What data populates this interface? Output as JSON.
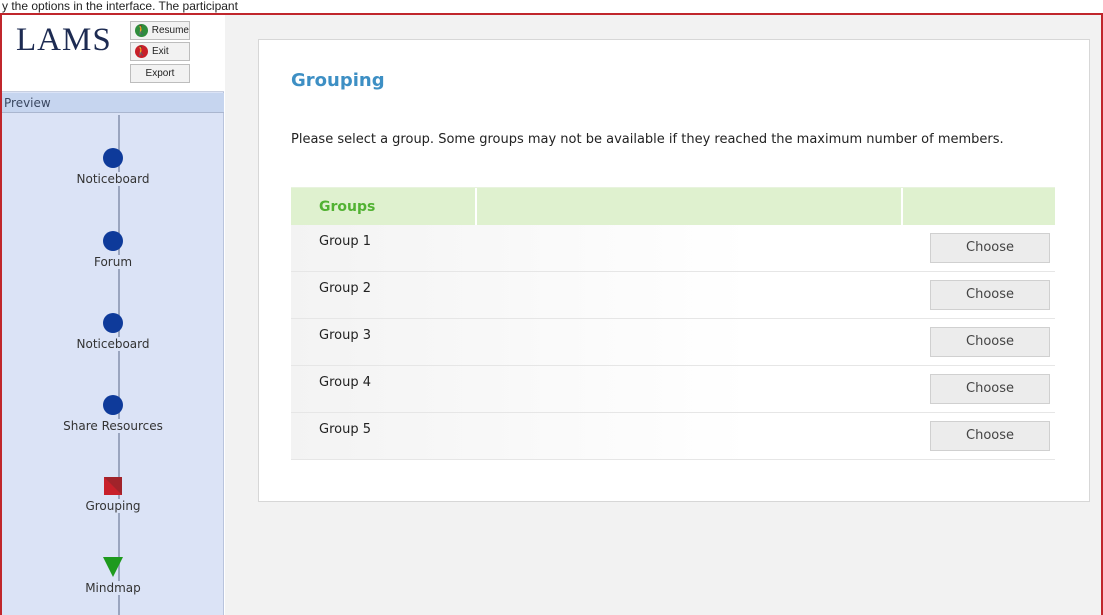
{
  "caption": "y the options in the interface. The participant",
  "toolbar": {
    "logo": "LAMS",
    "resume_label": "Resume",
    "exit_label": "Exit",
    "export_label": "Export",
    "resume_icon": "walking-person-icon",
    "exit_icon": "exit-person-icon"
  },
  "sidebar": {
    "preview_label": "Preview",
    "activities": [
      {
        "label": "Noticeboard",
        "shape": "circle"
      },
      {
        "label": "Forum",
        "shape": "circle"
      },
      {
        "label": "Noticeboard",
        "shape": "circle"
      },
      {
        "label": "Share Resources",
        "shape": "circle"
      },
      {
        "label": "Grouping",
        "shape": "square"
      },
      {
        "label": "Mindmap",
        "shape": "triangle"
      }
    ]
  },
  "main": {
    "title": "Grouping",
    "instructions": "Please select a group. Some groups may not be available if they reached the maximum number of members.",
    "table": {
      "header": "Groups",
      "rows": [
        {
          "name": "Group 1",
          "action": "Choose"
        },
        {
          "name": "Group 2",
          "action": "Choose"
        },
        {
          "name": "Group 3",
          "action": "Choose"
        },
        {
          "name": "Group 4",
          "action": "Choose"
        },
        {
          "name": "Group 5",
          "action": "Choose"
        }
      ]
    }
  },
  "colors": {
    "accent_title": "#3d8fc4",
    "header_green": "#52b233",
    "frame_red": "#c0262c",
    "sidebar_bg": "#dbe3f6"
  }
}
